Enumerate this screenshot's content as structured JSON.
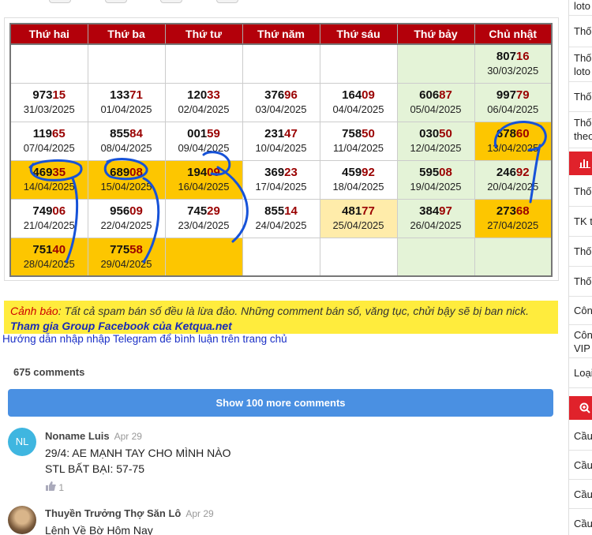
{
  "calendar": {
    "headers": [
      "Thứ hai",
      "Thứ ba",
      "Thứ tư",
      "Thứ năm",
      "Thứ sáu",
      "Thứ bảy",
      "Chủ nhật"
    ],
    "rows": [
      [
        {
          "h": "",
          "t": "",
          "d": ""
        },
        {
          "h": "",
          "t": "",
          "d": ""
        },
        {
          "h": "",
          "t": "",
          "d": ""
        },
        {
          "h": "",
          "t": "",
          "d": ""
        },
        {
          "h": "",
          "t": "",
          "d": ""
        },
        {
          "h": "",
          "t": "",
          "d": "",
          "bg": "wk"
        },
        {
          "h": "807",
          "t": "16",
          "d": "30/03/2025",
          "bg": "wk"
        }
      ],
      [
        {
          "h": "973",
          "t": "15",
          "d": "31/03/2025"
        },
        {
          "h": "133",
          "t": "71",
          "d": "01/04/2025"
        },
        {
          "h": "120",
          "t": "33",
          "d": "02/04/2025"
        },
        {
          "h": "376",
          "t": "96",
          "d": "03/04/2025"
        },
        {
          "h": "164",
          "t": "09",
          "d": "04/04/2025"
        },
        {
          "h": "606",
          "t": "87",
          "d": "05/04/2025",
          "bg": "wk"
        },
        {
          "h": "997",
          "t": "79",
          "d": "06/04/2025",
          "bg": "wk"
        }
      ],
      [
        {
          "h": "119",
          "t": "65",
          "d": "07/04/2025"
        },
        {
          "h": "855",
          "t": "84",
          "d": "08/04/2025"
        },
        {
          "h": "001",
          "t": "59",
          "d": "09/04/2025"
        },
        {
          "h": "231",
          "t": "47",
          "d": "10/04/2025"
        },
        {
          "h": "758",
          "t": "50",
          "d": "11/04/2025"
        },
        {
          "h": "030",
          "t": "50",
          "d": "12/04/2025",
          "bg": "wk"
        },
        {
          "h": "678",
          "t": "60",
          "d": "13/04/2025",
          "bg": "hl"
        }
      ],
      [
        {
          "h": "469",
          "t": "35",
          "d": "14/04/2025",
          "bg": "hl"
        },
        {
          "h": "689",
          "t": "08",
          "d": "15/04/2025",
          "bg": "hl"
        },
        {
          "h": "194",
          "t": "09",
          "d": "16/04/2025",
          "bg": "hl"
        },
        {
          "h": "369",
          "t": "23",
          "d": "17/04/2025"
        },
        {
          "h": "459",
          "t": "92",
          "d": "18/04/2025"
        },
        {
          "h": "595",
          "t": "08",
          "d": "19/04/2025",
          "bg": "wk"
        },
        {
          "h": "246",
          "t": "92",
          "d": "20/04/2025",
          "bg": "wk"
        }
      ],
      [
        {
          "h": "749",
          "t": "06",
          "d": "21/04/2025"
        },
        {
          "h": "956",
          "t": "09",
          "d": "22/04/2025"
        },
        {
          "h": "745",
          "t": "29",
          "d": "23/04/2025"
        },
        {
          "h": "855",
          "t": "14",
          "d": "24/04/2025"
        },
        {
          "h": "481",
          "t": "77",
          "d": "25/04/2025",
          "bg": "lt"
        },
        {
          "h": "384",
          "t": "97",
          "d": "26/04/2025",
          "bg": "wk"
        },
        {
          "h": "273",
          "t": "68",
          "d": "27/04/2025",
          "bg": "hl"
        }
      ],
      [
        {
          "h": "751",
          "t": "40",
          "d": "28/04/2025",
          "bg": "hl"
        },
        {
          "h": "775",
          "t": "58",
          "d": "29/04/2025",
          "bg": "hl"
        },
        {
          "h": "",
          "t": "",
          "d": "",
          "bg": "hl"
        },
        {
          "h": "",
          "t": "",
          "d": ""
        },
        {
          "h": "",
          "t": "",
          "d": ""
        },
        {
          "h": "",
          "t": "",
          "d": "",
          "bg": "wk"
        },
        {
          "h": "",
          "t": "",
          "d": "",
          "bg": "wk"
        }
      ]
    ]
  },
  "warning": {
    "label": "Cảnh báo",
    "text": ": Tất cả spam bán số đều là lừa đảo. Những comment bán số, văng tục, chửi bậy sẽ bị ban nick.",
    "facebook_link": "Tham gia Group Facebook của Ketqua.net"
  },
  "telegram_link": "Hướng dẫn nhập nhập Telegram để bình luận trên trang chủ",
  "comments": {
    "count_label": "675 comments",
    "show_more_label": "Show 100 more comments",
    "items": [
      {
        "initials": "NL",
        "author": "Noname Luis",
        "date": "Apr 29",
        "line1": "29/4: AE MẠNH TAY CHO MÌNH NÀO",
        "line2": "STL BẤT BẠI: 57-75",
        "likes": "1"
      },
      {
        "author": "Thuyền Trưởng Thợ Săn Lô",
        "date": "Apr 29",
        "line1": "Lệnh Về Bờ Hôm Nay"
      }
    ]
  },
  "sidebar": {
    "items": [
      "loto",
      "Thố",
      "Thố loto",
      "Thố",
      "Thố theo",
      "Thố",
      "TK t",
      "Thố",
      "Thố",
      "Côn",
      "Côn VIP",
      "Loại",
      "Cầu",
      "Cầu",
      "Cầu",
      "Cầu"
    ],
    "icons": [
      "chart-bar-icon",
      "zoom-icon"
    ]
  },
  "colors": {
    "header_red": "#b3000a",
    "highlight_yellow": "#fdc600",
    "weekend_green": "#e4f3d7",
    "warning_yellow": "#ffec3d",
    "button_blue": "#4a90e2"
  }
}
